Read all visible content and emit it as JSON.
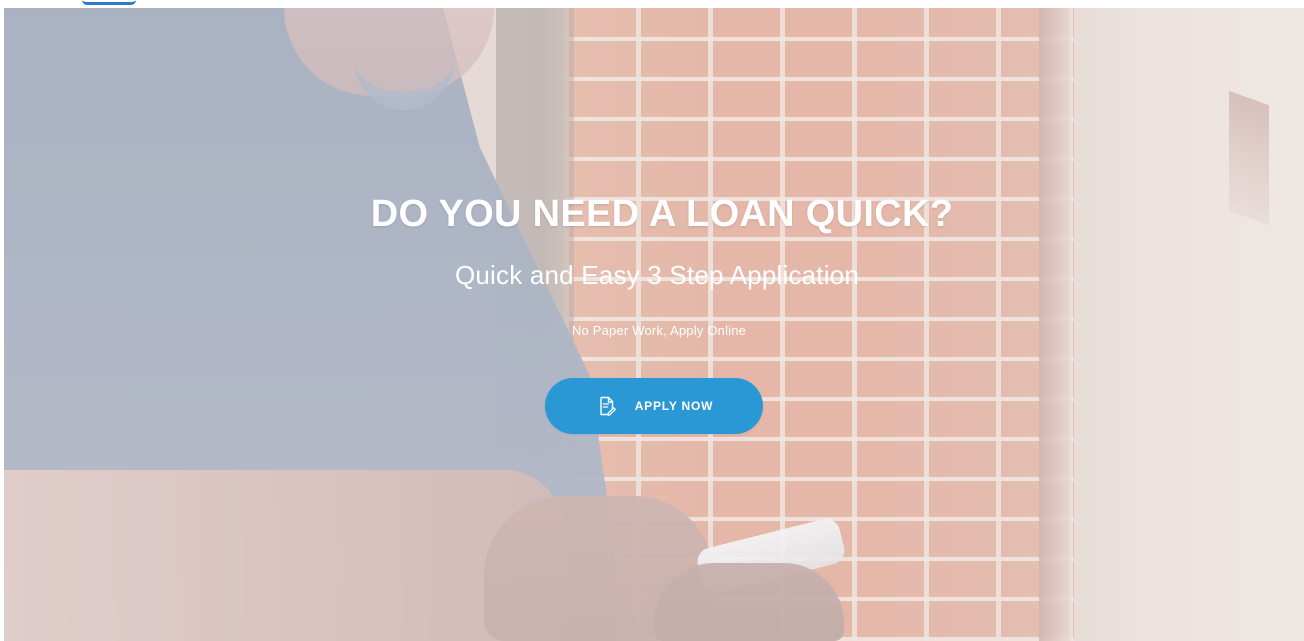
{
  "hero": {
    "title": "DO YOU NEED A LOAN QUICK?",
    "subtitle": "Quick and Easy 3 Step Application",
    "tagline": "No Paper Work, Apply Online",
    "button_label": "APPLY NOW",
    "button_icon": "document-signature-icon",
    "button_color": "#2b98d6",
    "text_color": "#ffffff"
  },
  "header": {
    "logo_icon": "logo-icon",
    "logo_color": "#2f79c9"
  }
}
